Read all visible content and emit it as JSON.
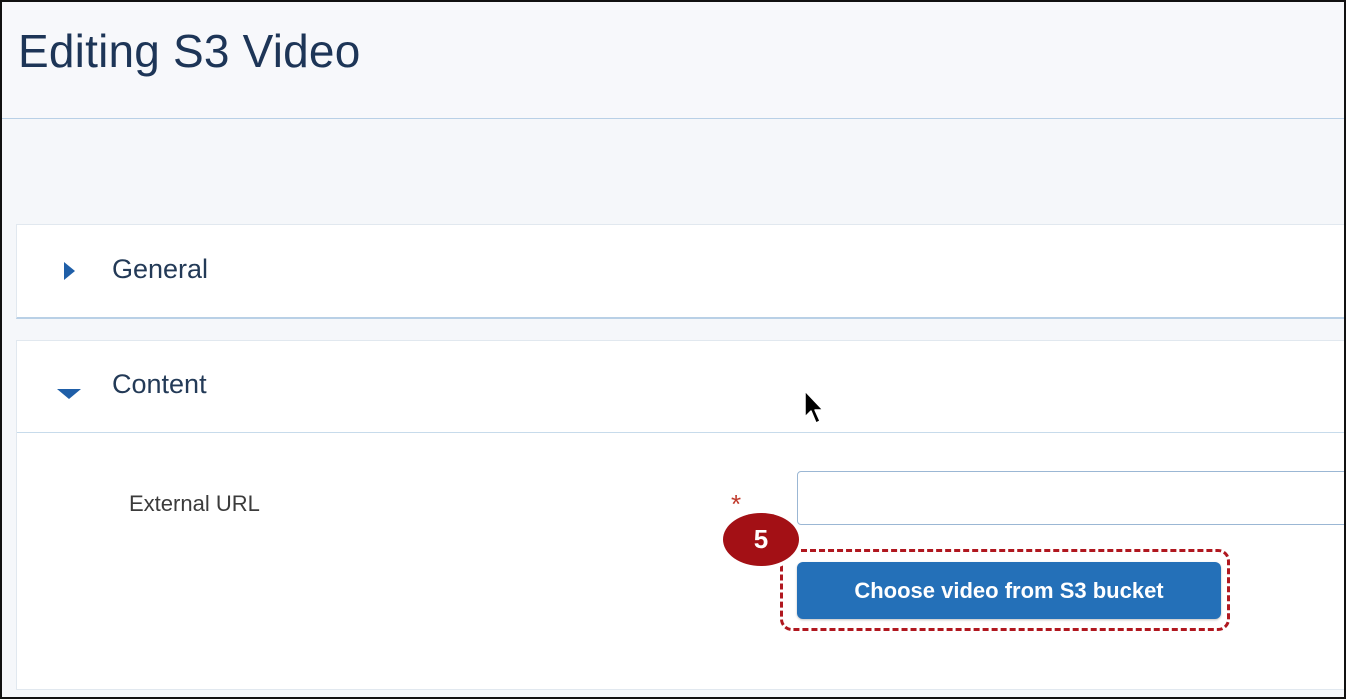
{
  "page": {
    "title": "Editing S3 Video"
  },
  "sections": [
    {
      "label": "General",
      "state": "collapsed",
      "icon": "caret-right-icon"
    },
    {
      "label": "Content",
      "state": "expanded",
      "icon": "caret-down-icon"
    }
  ],
  "content_form": {
    "external_url": {
      "label": "External URL",
      "required_marker": "*",
      "value": "",
      "placeholder": ""
    },
    "choose_button_label": "Choose video from S3 bucket"
  },
  "annotation": {
    "step_number": "5",
    "color": "#a31015"
  },
  "colors": {
    "accent": "#2470b8",
    "title_text": "#1d3557",
    "required": "#c0392b"
  }
}
